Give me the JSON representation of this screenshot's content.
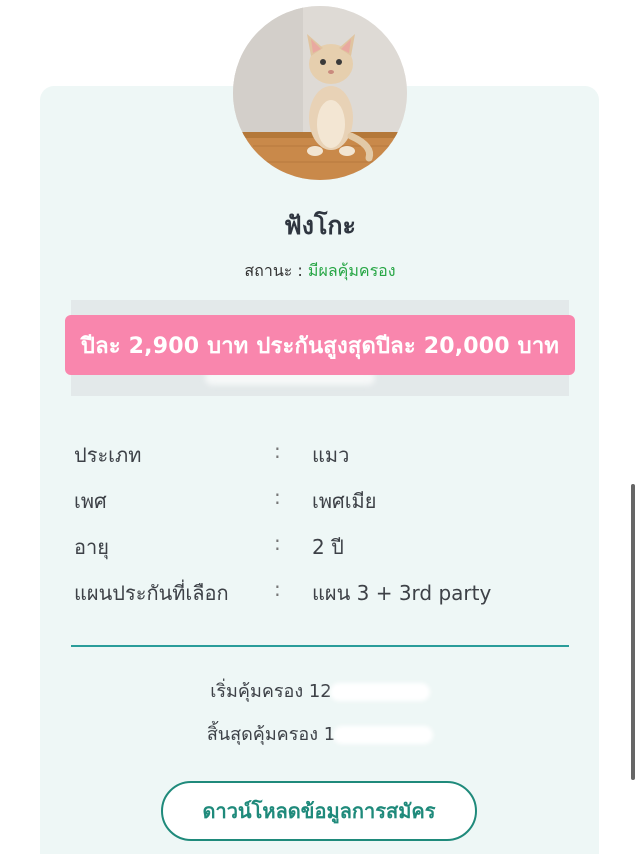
{
  "pet": {
    "name": "ฟังโกะ",
    "status_label": "สถานะ : ",
    "status_value": "มีผลคุ้มครอง",
    "photo_icon": "cat-photo"
  },
  "promo": {
    "text": "ปีละ 2,900 บาท ประกันสูงสุดปีละ 20,000 บาท"
  },
  "details": [
    {
      "label": "ประเภท",
      "colon": ":",
      "value": "แมว"
    },
    {
      "label": "เพศ",
      "colon": ":",
      "value": "เพศเมีย"
    },
    {
      "label": "อายุ",
      "colon": ":",
      "value": "2 ปี"
    },
    {
      "label": "แผนประกันที่เลือก",
      "colon": ":",
      "value": "แผน 3 + 3rd party"
    }
  ],
  "coverage": {
    "start_label": "เริ่มคุ้มครอง 12",
    "end_label": "สิ้นสุดคุ้มครอง 1"
  },
  "actions": {
    "download_label": "ดาวน์โหลดข้อมูลการสมัคร"
  },
  "colors": {
    "accent": "#1f8a7b",
    "promo": "#f986ad",
    "status_active": "#27a645",
    "card_bg": "#eef7f6"
  }
}
